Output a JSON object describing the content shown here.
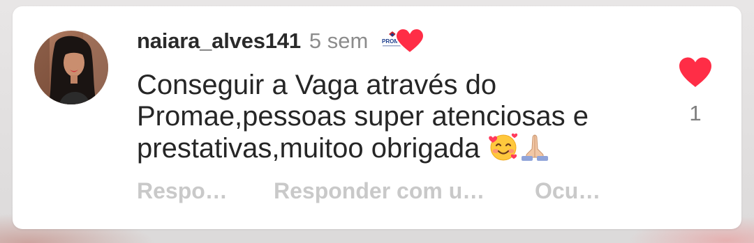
{
  "comment": {
    "username": "naiara_alves141",
    "time": "5 sem",
    "text": "Conseguir a Vaga através do Promae,pessoas super atenciosas e prestativas,muitoo obrigada",
    "emojis": [
      "smiling-face-with-hearts-icon",
      "folded-hands-icon"
    ],
    "creator_like_badge": {
      "logo_text": "PROMA",
      "icon": "heart-icon"
    },
    "like": {
      "icon": "heart-icon",
      "liked": true,
      "count": "1"
    },
    "actions": {
      "reply": "Respo…",
      "reply_with": "Responder com u…",
      "hide": "Ocu…"
    }
  },
  "colors": {
    "heart": "#ff2d46",
    "username": "#2a2a2a",
    "secondary_text": "#8c8c8c",
    "action_text": "#c9c9c9"
  }
}
